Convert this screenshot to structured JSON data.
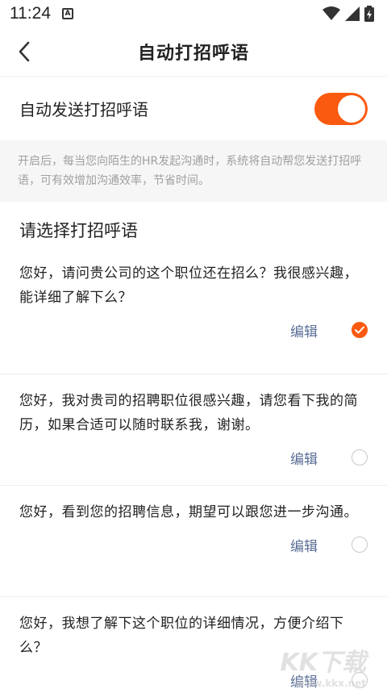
{
  "status_bar": {
    "time": "11:24",
    "notification_glyph": "A"
  },
  "nav": {
    "title": "自动打招呼语"
  },
  "auto_greeting": {
    "label": "自动发送打招呼语",
    "enabled": true
  },
  "description": "开启后，每当您向陌生的HR发起沟通时，系统将自动帮您发送打招呼语，可有效增加沟通效率，节省时间。",
  "section_title": "请选择打招呼语",
  "options": [
    {
      "text": "您好，请问贵公司的这个职位还在招么？我很感兴趣，能详细了解下么？",
      "edit_label": "编辑",
      "selected": true
    },
    {
      "text": "您好，我对贵司的招聘职位很感兴趣，请您看下我的简历，如果合适可以随时联系我，谢谢。",
      "edit_label": "编辑",
      "selected": false
    },
    {
      "text": "您好，看到您的招聘信息，期望可以跟您进一步沟通。",
      "edit_label": "编辑",
      "selected": false
    },
    {
      "text": "您好，我想了解下这个职位的详细情况，方便介绍下么？",
      "edit_label": "编辑",
      "selected": false
    }
  ],
  "watermark": {
    "main": "KK下载",
    "sub": "www.kkx.net"
  },
  "colors": {
    "accent": "#fa5a0f",
    "edit_link": "#5a6e96",
    "description_bg": "#f6f6f6",
    "description_text": "#a0a0a0"
  }
}
